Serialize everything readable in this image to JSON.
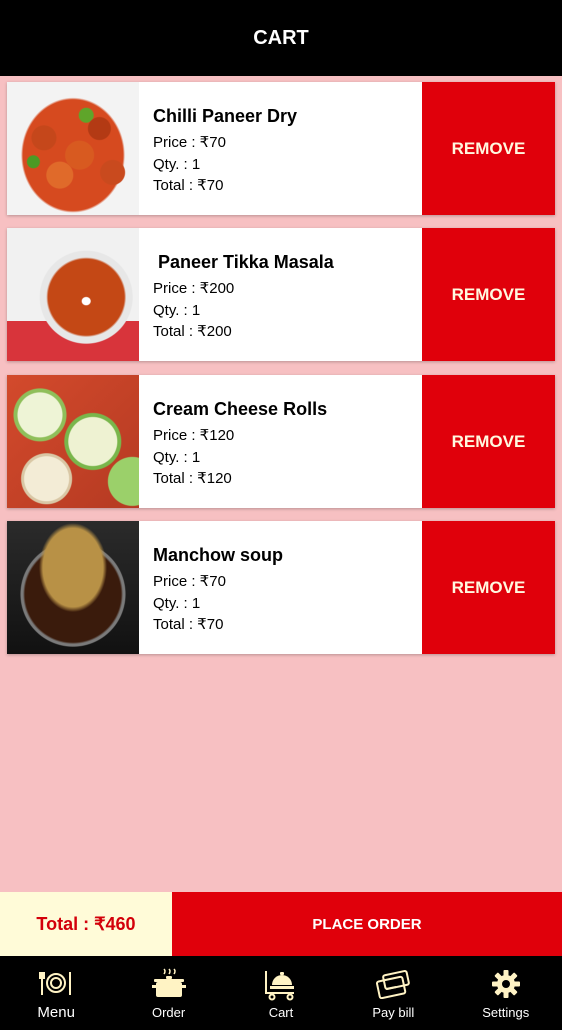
{
  "header": {
    "title": "CART"
  },
  "items": [
    {
      "name": "Chilli Paneer Dry",
      "price": "Price : ₹70",
      "qty": "Qty. : 1",
      "total": "Total : ₹70",
      "remove": "REMOVE"
    },
    {
      "name": " Paneer Tikka Masala",
      "price": "Price : ₹200",
      "qty": "Qty. : 1",
      "total": "Total : ₹200",
      "remove": "REMOVE"
    },
    {
      "name": "Cream Cheese Rolls",
      "price": "Price : ₹120",
      "qty": "Qty. : 1",
      "total": "Total : ₹120",
      "remove": "REMOVE"
    },
    {
      "name": "Manchow soup",
      "price": "Price : ₹70",
      "qty": "Qty. : 1",
      "total": "Total : ₹70",
      "remove": "REMOVE"
    }
  ],
  "footer": {
    "total": "Total : ₹460",
    "place_order": "PLACE ORDER"
  },
  "nav": [
    {
      "label": "Menu",
      "icon": "plate-cutlery-icon"
    },
    {
      "label": "Order",
      "icon": "cooking-pot-icon"
    },
    {
      "label": "Cart",
      "icon": "serving-cart-icon"
    },
    {
      "label": "Pay bill",
      "icon": "wallet-card-icon"
    },
    {
      "label": "Settings",
      "icon": "gear-icon"
    }
  ],
  "colors": {
    "accent": "#e0000b",
    "background": "#f7c0c2",
    "total_bg": "#fffbd8",
    "nav_icon": "#fff3c4"
  }
}
